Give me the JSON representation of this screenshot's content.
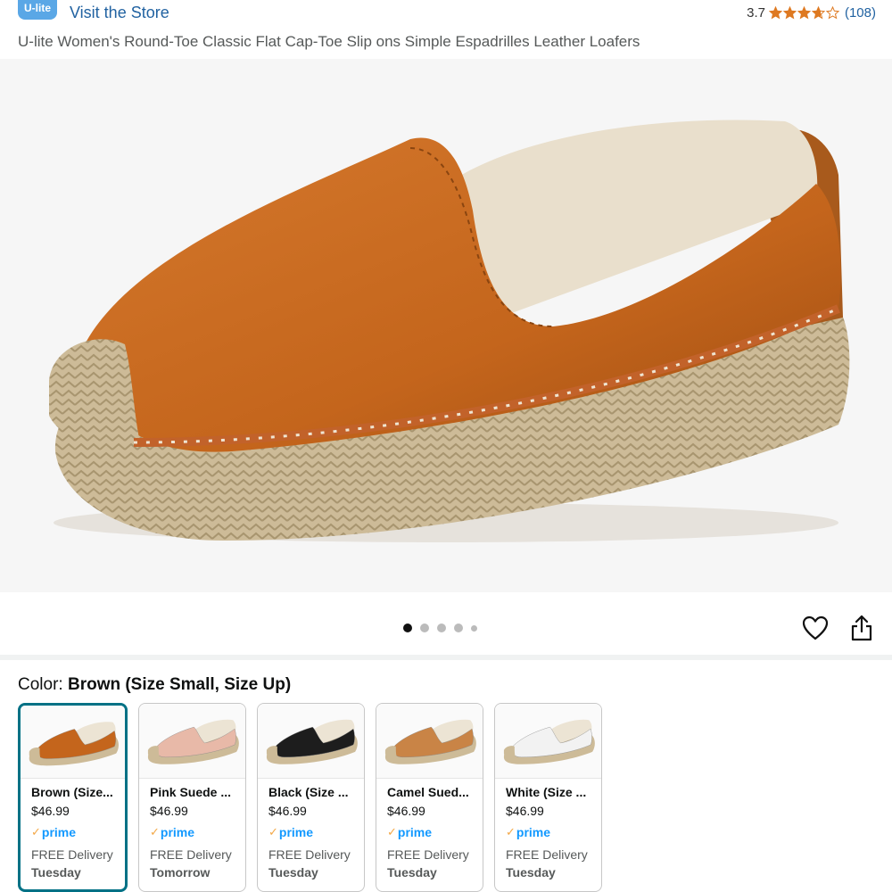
{
  "store": {
    "logo_text": "U-lite",
    "link_label": "Visit the Store"
  },
  "rating": {
    "value": "3.7",
    "stars_filled": 3.7,
    "count": "(108)"
  },
  "product": {
    "title": "U-lite Women's Round-Toe Classic Flat Cap-Toe Slip ons Simple Espadrilles Leather Loafers"
  },
  "gallery": {
    "image_count": 5,
    "current_index": 1,
    "main_image_icon": "brown-leather-espadrille-photo",
    "colors": {
      "leather": "#c4651c",
      "leather_dark": "#a04e12",
      "jute": "#cdbb98",
      "insole": "#e9dfcc",
      "background": "#f6f6f6"
    }
  },
  "actions": {
    "wishlist_icon": "heart-icon",
    "share_icon": "share-icon"
  },
  "color_selector": {
    "label": "Color:",
    "selected": "Brown (Size Small, Size Up)",
    "accent_color": "#007185",
    "options": [
      {
        "name": "Brown (Size...",
        "price": "$46.99",
        "prime": "prime",
        "delivery": "FREE Delivery",
        "day": "Tuesday",
        "color": "#c4651c",
        "selected": true
      },
      {
        "name": "Pink Suede ...",
        "price": "$46.99",
        "prime": "prime",
        "delivery": "FREE Delivery",
        "day": "Tomorrow",
        "color": "#e8b9a8",
        "selected": false
      },
      {
        "name": "Black (Size ...",
        "price": "$46.99",
        "prime": "prime",
        "delivery": "FREE Delivery",
        "day": "Tuesday",
        "color": "#1d1d1d",
        "selected": false
      },
      {
        "name": "Camel Sued...",
        "price": "$46.99",
        "prime": "prime",
        "delivery": "FREE Delivery",
        "day": "Tuesday",
        "color": "#c98446",
        "selected": false
      },
      {
        "name": "White (Size ...",
        "price": "$46.99",
        "prime": "prime",
        "delivery": "FREE Delivery",
        "day": "Tuesday",
        "color": "#f2f2f2",
        "selected": false
      }
    ]
  }
}
